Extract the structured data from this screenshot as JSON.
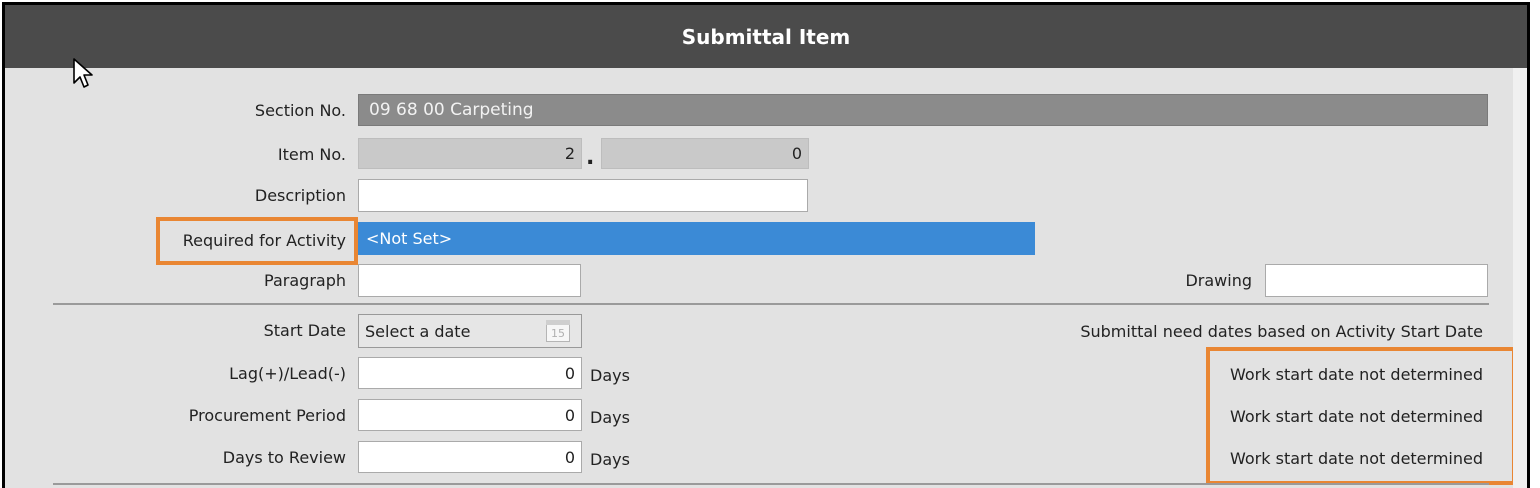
{
  "window": {
    "title": "Submittal Item"
  },
  "form": {
    "section_no": {
      "label": "Section No.",
      "value": "09 68 00 Carpeting"
    },
    "item_no": {
      "label": "Item No.",
      "major": "2",
      "separator": ".",
      "minor": "0"
    },
    "description": {
      "label": "Description",
      "value": ""
    },
    "required_for_activity": {
      "label": "Required for Activity",
      "value": "<Not Set>"
    },
    "paragraph": {
      "label": "Paragraph",
      "value": ""
    },
    "drawing": {
      "label": "Drawing",
      "value": ""
    },
    "start_date": {
      "label": "Start Date",
      "placeholder": "Select a date",
      "calendar_day": "15"
    },
    "need_dates_header": "Submittal need dates based on Activity Start Date",
    "lag_lead": {
      "label": "Lag(+)/Lead(-)",
      "value": "0",
      "unit": "Days",
      "status": "Work start date not determined"
    },
    "procurement_period": {
      "label": "Procurement Period",
      "value": "0",
      "unit": "Days",
      "status": "Work start date not determined"
    },
    "days_to_review": {
      "label": "Days to Review",
      "value": "0",
      "unit": "Days",
      "status": "Work start date not determined"
    }
  },
  "colors": {
    "title_bar": "#4b4b4b",
    "panel_bg": "#e2e2e2",
    "selection_blue": "#3b8ad6",
    "highlight_orange": "#e98633"
  }
}
